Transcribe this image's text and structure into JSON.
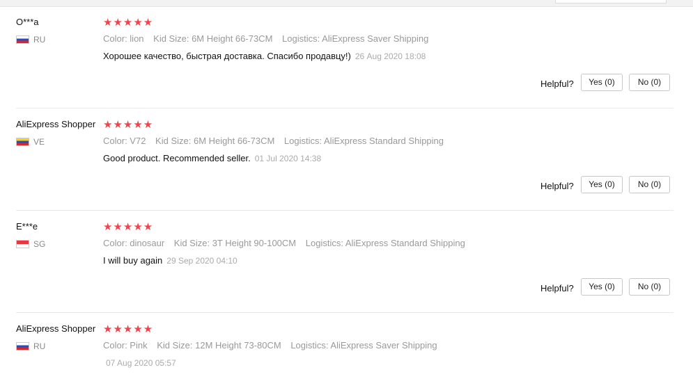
{
  "reviews": [
    {
      "user": "O***a",
      "country": "RU",
      "stars": "★★★★★",
      "color": "Color: lion",
      "size": "Kid Size: 6M Height 66-73CM",
      "logistics": "Logistics: AliExpress Saver Shipping",
      "text": "Хорошее качество, быстрая доставка. Спасибо продавцу!)",
      "date": "26 Aug 2020 18:08",
      "helpful_label": "Helpful?",
      "yes_label": "Yes (0)",
      "no_label": "No (0)"
    },
    {
      "user": "AliExpress Shopper",
      "country": "VE",
      "stars": "★★★★★",
      "color": "Color: V72",
      "size": "Kid Size: 6M Height 66-73CM",
      "logistics": "Logistics: AliExpress Standard Shipping",
      "text": "Good product. Recommended seller.",
      "date": "01 Jul 2020 14:38",
      "helpful_label": "Helpful?",
      "yes_label": "Yes (0)",
      "no_label": "No (0)"
    },
    {
      "user": "E***e",
      "country": "SG",
      "stars": "★★★★★",
      "color": "Color: dinosaur",
      "size": "Kid Size: 3T Height 90-100CM",
      "logistics": "Logistics: AliExpress Standard Shipping",
      "text": "I will buy again",
      "date": "29 Sep 2020 04:10",
      "helpful_label": "Helpful?",
      "yes_label": "Yes (0)",
      "no_label": "No (0)"
    },
    {
      "user": "AliExpress Shopper",
      "country": "RU",
      "stars": "★★★★★",
      "color": "Color: Pink",
      "size": "Kid Size: 12M Height 73-80CM",
      "logistics": "Logistics: AliExpress Saver Shipping",
      "date": "07 Aug 2020 05:57"
    }
  ]
}
